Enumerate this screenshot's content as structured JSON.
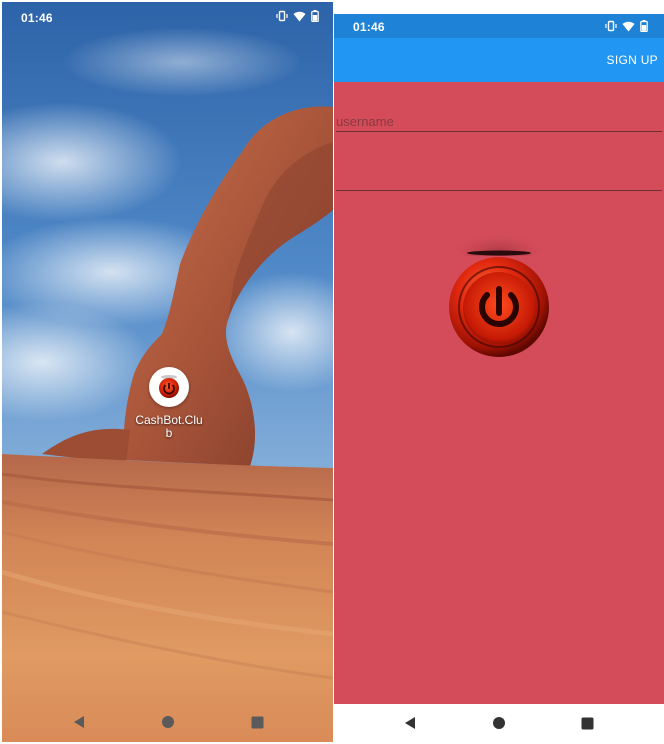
{
  "home_screen": {
    "status_bar": {
      "time": "01:46"
    },
    "app_shortcut": {
      "label": "CashBot.Club",
      "icon": "power-icon"
    },
    "nav_bar": {
      "back": "back-icon",
      "home": "home-icon",
      "recents": "recents-icon"
    }
  },
  "app_screen": {
    "status_bar": {
      "time": "01:46"
    },
    "toolbar": {
      "signup_label": "SIGN UP"
    },
    "login_form": {
      "username": {
        "value": "",
        "placeholder": "username"
      },
      "password": {
        "value": "",
        "placeholder": ""
      }
    },
    "power_button": {
      "icon": "power-icon"
    },
    "nav_bar": {
      "back": "back-icon",
      "home": "home-icon",
      "recents": "recents-icon"
    }
  },
  "colors": {
    "app_background": "#d44c5a",
    "toolbar": "#2196f3",
    "status_bar": "#1e82d6",
    "power_red": "#e22a10"
  }
}
